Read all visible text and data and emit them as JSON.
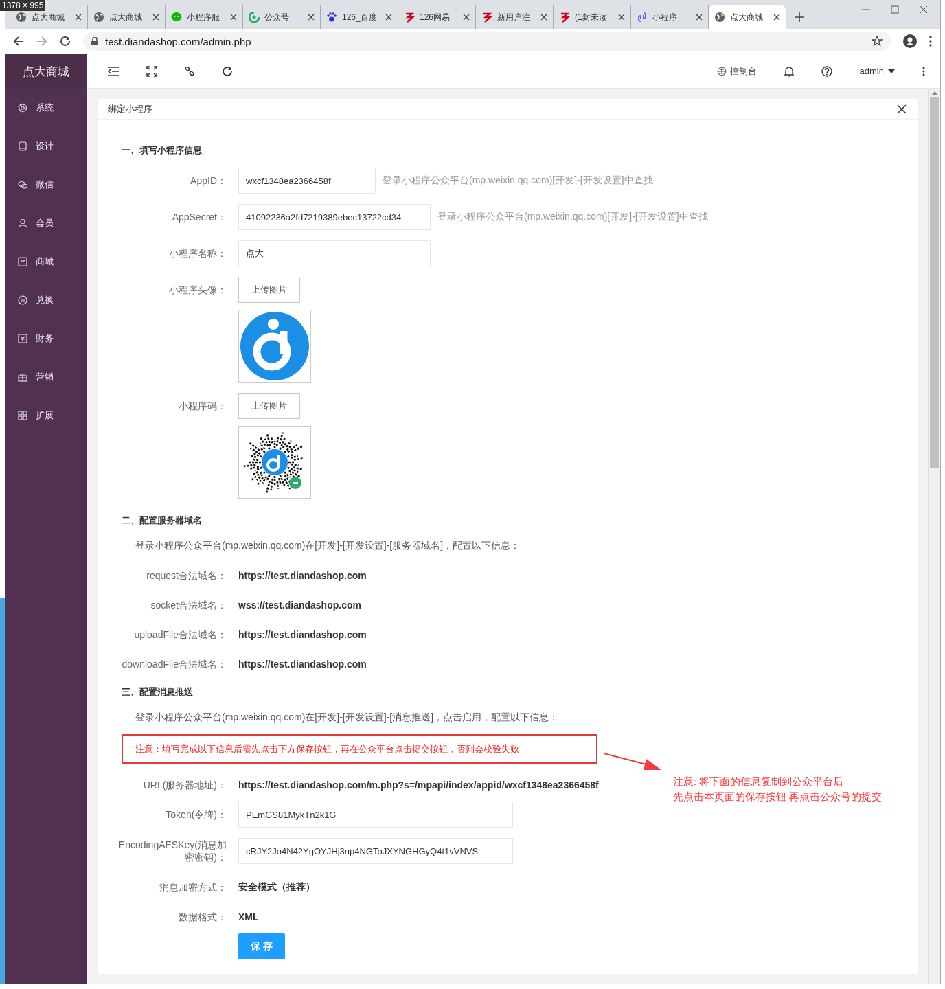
{
  "size_label": "1378 × 995",
  "browser": {
    "tabs": [
      {
        "title": "点大商城",
        "selected": false
      },
      {
        "title": "点大商城",
        "selected": false
      },
      {
        "title": "小程序服",
        "selected": false
      },
      {
        "title": "公众号",
        "selected": false
      },
      {
        "title": "126_百度",
        "selected": false
      },
      {
        "title": "126网易",
        "selected": false
      },
      {
        "title": "新用户注",
        "selected": false
      },
      {
        "title": "(1封未读",
        "selected": false
      },
      {
        "title": "小程序",
        "selected": false
      },
      {
        "title": "点大商城",
        "selected": true
      }
    ],
    "url": "test.diandashop.com/admin.php"
  },
  "sidebar": {
    "brand": "点大商城",
    "items": [
      {
        "label": "系统"
      },
      {
        "label": "设计"
      },
      {
        "label": "微信"
      },
      {
        "label": "会员"
      },
      {
        "label": "商城"
      },
      {
        "label": "兑换"
      },
      {
        "label": "财务"
      },
      {
        "label": "营销"
      },
      {
        "label": "扩展"
      }
    ]
  },
  "topbar": {
    "console": "控制台",
    "user": "admin"
  },
  "modal": {
    "title": "绑定小程序",
    "sections": [
      {
        "title": "一、填写小程序信息",
        "rows": [
          {
            "kind": "input",
            "label": "AppID：",
            "value": "wxcf1348ea2366458f",
            "hint": "登录小程序公众平台(mp.weixin.qq.com)[开发]-[开发设置]中查找"
          },
          {
            "kind": "input",
            "label": "AppSecret：",
            "value": "41092236a2fd7219389ebec13722cd34",
            "hint": "登录小程序公众平台(mp.weixin.qq.com)[开发]-[开发设置]中查找"
          },
          {
            "kind": "input",
            "label": "小程序名称：",
            "value": "点大"
          },
          {
            "kind": "upload",
            "label": "小程序头像：",
            "button": "上传图片"
          },
          {
            "kind": "upload",
            "label": "小程序码：",
            "button": "上传图片"
          }
        ]
      },
      {
        "title": "二、配置服务器域名",
        "rows": [
          {
            "kind": "paragraph",
            "text": "登录小程序公众平台(mp.weixin.qq.com)在[开发]-[开发设置]-[服务器域名]，配置以下信息："
          },
          {
            "kind": "text",
            "label": "request合法域名：",
            "value": "https://test.diandashop.com"
          },
          {
            "kind": "text",
            "label": "socket合法域名：",
            "value": "wss://test.diandashop.com"
          },
          {
            "kind": "text",
            "label": "uploadFile合法域名：",
            "value": "https://test.diandashop.com"
          },
          {
            "kind": "text",
            "label": "downloadFile合法域名：",
            "value": "https://test.diandashop.com"
          }
        ]
      },
      {
        "title": "三、配置消息推送",
        "rows": [
          {
            "kind": "paragraph",
            "text": "登录小程序公众平台(mp.weixin.qq.com)在[开发]-[开发设置]-[消息推送]，点击启用，配置以下信息："
          },
          {
            "kind": "warning",
            "text": "注意：填写完成以下信息后需先点击下方保存按钮，再在公众平台点击提交按钮，否则会校验失败",
            "note": [
              "注意: 将下面的信息复制到公众平台后",
              "先点击本页面的保存按钮 再点击公众号的提交"
            ]
          },
          {
            "kind": "text",
            "label": "URL(服务器地址)：",
            "value": "https://test.diandashop.com/m.php?s=/mpapi/index/appid/wxcf1348ea2366458f"
          },
          {
            "kind": "input",
            "label": "Token(令牌)：",
            "value": "PEmGS81MykTn2k1G"
          },
          {
            "kind": "input",
            "label": "EncodingAESKey(消息加密密钥)：",
            "value": "cRJY2Jo4N42YgOYJHj3np4NGToJXYNGHGyQ4t1vVNVS"
          },
          {
            "kind": "text",
            "label": "消息加密方式：",
            "value": "安全模式（推荐）"
          },
          {
            "kind": "text",
            "label": "数据格式：",
            "value": "XML"
          },
          {
            "kind": "button",
            "label": "保 存"
          }
        ]
      }
    ]
  }
}
